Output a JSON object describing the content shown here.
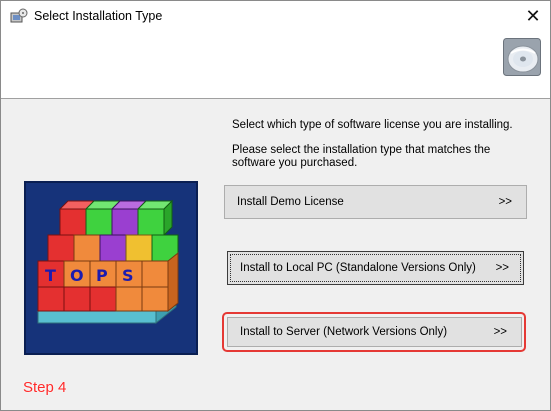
{
  "window": {
    "title": "Select Installation Type",
    "close_glyph": "✕"
  },
  "header": {
    "icon": "cd-disc-icon"
  },
  "content": {
    "prompt_primary": "Select which type of software license you are installing.",
    "prompt_secondary": "Please select the installation type that matches the software you  purchased.",
    "logo_letters": [
      "T",
      "O",
      "P",
      "S"
    ],
    "buttons": [
      {
        "label": "Install Demo License",
        "arrow": ">>"
      },
      {
        "label": "Install to Local PC  (Standalone Versions Only)",
        "arrow": ">>"
      },
      {
        "label": "Install to Server (Network Versions Only)",
        "arrow": ">>"
      }
    ],
    "step_label": "Step 4"
  },
  "colors": {
    "highlight": "#e53935",
    "step_text": "#ff2a2a",
    "logo_background": "#16337a"
  }
}
